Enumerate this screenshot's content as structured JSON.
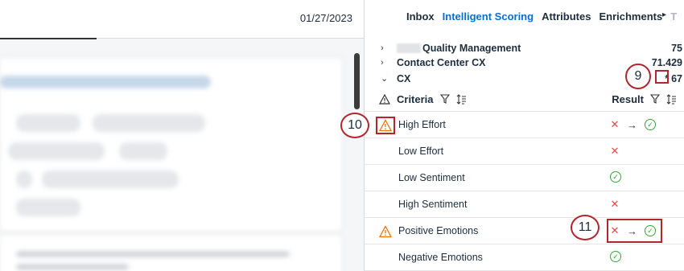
{
  "left": {
    "date": "01/27/2023"
  },
  "tabs": [
    {
      "label": "Inbox",
      "active": false
    },
    {
      "label": "Intelligent Scoring",
      "active": true
    },
    {
      "label": "Attributes",
      "active": false
    },
    {
      "label": "Enrichments",
      "active": false
    },
    {
      "label": "T",
      "active": false
    }
  ],
  "groups": [
    {
      "label": "Quality Management",
      "score": "75",
      "chevron": "›"
    },
    {
      "label": "Contact Center CX",
      "score": "71.429",
      "chevron": "›"
    },
    {
      "label": "CX",
      "score": "67",
      "score_marker": "*",
      "chevron": "⌄"
    }
  ],
  "criteria_header": {
    "criteria": "Criteria",
    "result": "Result"
  },
  "criteria": [
    {
      "label": "High Effort",
      "warning": true,
      "result": "changed-x-to-check"
    },
    {
      "label": "Low Effort",
      "warning": false,
      "result": "x"
    },
    {
      "label": "Low Sentiment",
      "warning": false,
      "result": "check"
    },
    {
      "label": "High Sentiment",
      "warning": false,
      "result": "x"
    },
    {
      "label": "Positive Emotions",
      "warning": true,
      "result": "changed-x-to-check"
    },
    {
      "label": "Negative Emotions",
      "warning": false,
      "result": "check"
    }
  ],
  "callouts": {
    "c9": "9",
    "c10": "10",
    "c11": "11"
  },
  "colors": {
    "accent": "#0a6ed1",
    "callout": "#b2262e",
    "error": "#e8484d",
    "success": "#3aa33a",
    "warning": "#e9730c"
  }
}
